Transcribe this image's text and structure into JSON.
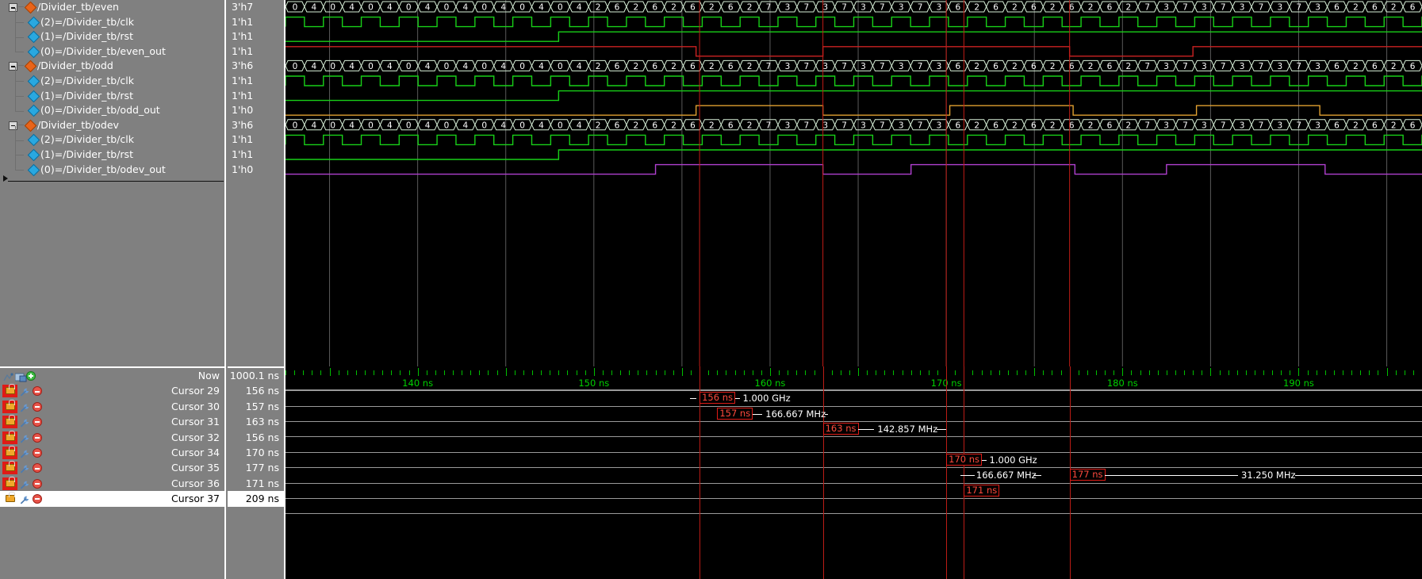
{
  "panels": {
    "name_col_header": "",
    "value_col_header": ""
  },
  "signals": [
    {
      "type": "group",
      "icon": "orange-diamond-icon",
      "label": "/Divider_tb/even",
      "value": "3'h7"
    },
    {
      "type": "child",
      "icon": "blue-diamond-icon",
      "label": "(2)=/Divider_tb/clk",
      "value": "1'h1"
    },
    {
      "type": "child",
      "icon": "blue-diamond-icon",
      "label": "(1)=/Divider_tb/rst",
      "value": "1'h1"
    },
    {
      "type": "childlast",
      "icon": "blue-diamond-icon",
      "label": "(0)=/Divider_tb/even_out",
      "value": "1'h1"
    },
    {
      "type": "group",
      "icon": "orange-diamond-icon",
      "label": "/Divider_tb/odd",
      "value": "3'h6"
    },
    {
      "type": "child",
      "icon": "blue-diamond-icon",
      "label": "(2)=/Divider_tb/clk",
      "value": "1'h1"
    },
    {
      "type": "child",
      "icon": "blue-diamond-icon",
      "label": "(1)=/Divider_tb/rst",
      "value": "1'h1"
    },
    {
      "type": "childlast",
      "icon": "blue-diamond-icon",
      "label": "(0)=/Divider_tb/odd_out",
      "value": "1'h0"
    },
    {
      "type": "group",
      "icon": "orange-diamond-icon",
      "label": "/Divider_tb/odev",
      "value": "3'h6"
    },
    {
      "type": "child",
      "icon": "blue-diamond-icon",
      "label": "(2)=/Divider_tb/clk",
      "value": "1'h1"
    },
    {
      "type": "child",
      "icon": "blue-diamond-icon",
      "label": "(1)=/Divider_tb/rst",
      "value": "1'h1"
    },
    {
      "type": "childlast",
      "icon": "blue-diamond-icon",
      "label": "(0)=/Divider_tb/odev_out",
      "value": "1'h0"
    }
  ],
  "cursors": [
    {
      "name": "Now",
      "value": "1000.1 ns",
      "locked": false,
      "selected": false,
      "is_now": true
    },
    {
      "name": "Cursor 29",
      "value": "156 ns",
      "locked": true,
      "selected": false,
      "is_now": false
    },
    {
      "name": "Cursor 30",
      "value": "157 ns",
      "locked": true,
      "selected": false,
      "is_now": false
    },
    {
      "name": "Cursor 31",
      "value": "163 ns",
      "locked": true,
      "selected": false,
      "is_now": false
    },
    {
      "name": "Cursor 32",
      "value": "156 ns",
      "locked": true,
      "selected": false,
      "is_now": false
    },
    {
      "name": "Cursor 34",
      "value": "170 ns",
      "locked": true,
      "selected": false,
      "is_now": false
    },
    {
      "name": "Cursor 35",
      "value": "177 ns",
      "locked": true,
      "selected": false,
      "is_now": false
    },
    {
      "name": "Cursor 36",
      "value": "171 ns",
      "locked": true,
      "selected": false,
      "is_now": false
    },
    {
      "name": "Cursor 37",
      "value": "209 ns",
      "locked": false,
      "selected": true,
      "is_now": false
    }
  ],
  "timeline": {
    "start_ns": 132.5,
    "end_ns": 197.0,
    "minor_tick_ns": 0.5,
    "major_tick_ns": 5,
    "labels": [
      {
        "text": "140 ns",
        "ns": 140
      },
      {
        "text": "150 ns",
        "ns": 150
      },
      {
        "text": "160 ns",
        "ns": 160
      },
      {
        "text": "170 ns",
        "ns": 170
      },
      {
        "text": "180 ns",
        "ns": 180
      },
      {
        "text": "190 ns",
        "ns": 190
      }
    ]
  },
  "measurements": [
    {
      "row": 1,
      "left_ns": 155.3,
      "box_ns": 156,
      "box_text": "156 ns",
      "freq": "1.000 GHz",
      "freq_side": "right",
      "line_ns": 155.3,
      "dash": true
    },
    {
      "row": 2,
      "box_ns": 157,
      "box_text": "157 ns",
      "freq": "166.667 MHz",
      "freq_side": "right",
      "line_to_ns": 163.3
    },
    {
      "row": 3,
      "box_ns": 163,
      "box_text": "163 ns",
      "freq": "142.857 MHz",
      "freq_side": "right",
      "line_to_ns": 170.0
    },
    {
      "row": 5,
      "box_ns": 170,
      "box_text": "170 ns",
      "freq": "1.000 GHz",
      "freq_side": "right"
    },
    {
      "row": 6,
      "box_ns": 177,
      "box_text": "177 ns",
      "freq_left": "166.667 MHz",
      "freq": "31.250 MHz",
      "freq_side": "right",
      "line_from_ns": 170.8,
      "line_to_ns": 197.0
    },
    {
      "row": 7,
      "box_ns": 171,
      "box_text": "171 ns",
      "freq": ""
    }
  ],
  "cursor_markers_ns": [
    156,
    163,
    170,
    171,
    177
  ],
  "waveform_groups": [
    {
      "name": "even",
      "bus_values": [
        "0",
        "4",
        "0",
        "4",
        "0",
        "4",
        "0",
        "4",
        "0",
        "4",
        "0",
        "4",
        "0",
        "4",
        "0",
        "4",
        "2",
        "6",
        "2",
        "6",
        "2",
        "6",
        "2",
        "6",
        "2",
        "7",
        "3",
        "7",
        "3",
        "7",
        "3",
        "7",
        "3",
        "7",
        "3",
        "6",
        "2",
        "6",
        "2",
        "6",
        "2",
        "6",
        "2",
        "6",
        "2",
        "7",
        "3",
        "7",
        "3",
        "7",
        "3",
        "7",
        "3",
        "7",
        "3",
        "6",
        "2",
        "6",
        "2",
        "6"
      ],
      "clk_color": "#18d018",
      "rst_color": "#18d018",
      "out_color": "#cc2222",
      "out_name": "even_out"
    },
    {
      "name": "odd",
      "bus_values": [
        "0",
        "4",
        "0",
        "4",
        "0",
        "4",
        "0",
        "4",
        "0",
        "4",
        "0",
        "4",
        "0",
        "4",
        "0",
        "4",
        "2",
        "6",
        "2",
        "6",
        "2",
        "6",
        "2",
        "6",
        "2",
        "7",
        "3",
        "7",
        "3",
        "7",
        "3",
        "7",
        "3",
        "7",
        "3",
        "6",
        "2",
        "6",
        "2",
        "6",
        "2",
        "6",
        "2",
        "6",
        "2",
        "7",
        "3",
        "7",
        "3",
        "7",
        "3",
        "7",
        "3",
        "7",
        "3",
        "6",
        "2",
        "6",
        "2",
        "6"
      ],
      "clk_color": "#18d018",
      "rst_color": "#18d018",
      "out_color": "#e0a030",
      "out_name": "odd_out"
    },
    {
      "name": "odev",
      "bus_values": [
        "0",
        "4",
        "0",
        "4",
        "0",
        "4",
        "0",
        "4",
        "0",
        "4",
        "0",
        "4",
        "0",
        "4",
        "0",
        "4",
        "2",
        "6",
        "2",
        "6",
        "2",
        "6",
        "2",
        "6",
        "2",
        "7",
        "3",
        "7",
        "3",
        "7",
        "3",
        "7",
        "3",
        "7",
        "3",
        "6",
        "2",
        "6",
        "2",
        "6",
        "2",
        "6",
        "2",
        "6",
        "2",
        "7",
        "3",
        "7",
        "3",
        "7",
        "3",
        "7",
        "3",
        "7",
        "3",
        "6",
        "2",
        "6",
        "2",
        "6"
      ],
      "clk_color": "#18d018",
      "rst_color": "#18d018",
      "out_color": "#b040d0",
      "out_name": "odev_out"
    }
  ],
  "colors": {
    "panel_bg": "#808080",
    "wave_bg": "#000000",
    "green": "#18d018",
    "red_cursor": "#e01b16",
    "orange": "#e0a030",
    "purple": "#b040d0",
    "ruler_green": "#00c800",
    "selected_row": "#ffffff"
  }
}
